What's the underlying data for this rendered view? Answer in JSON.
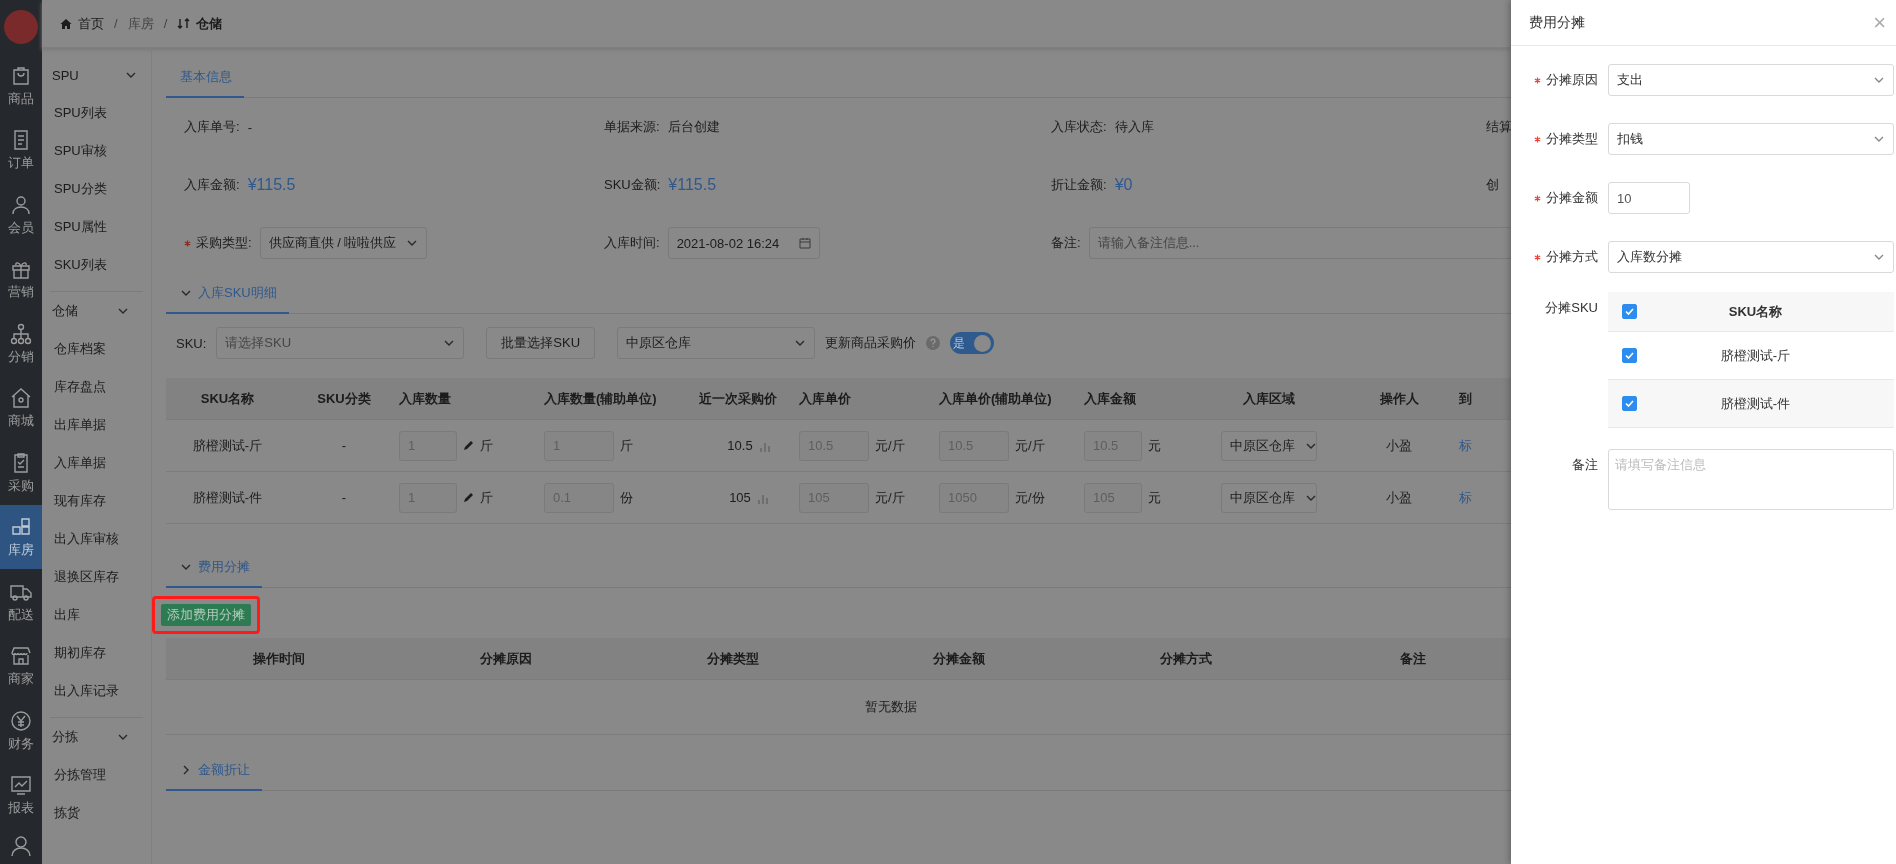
{
  "nav_rail": {
    "items": [
      {
        "label": "商品",
        "selected": false
      },
      {
        "label": "订单",
        "selected": false
      },
      {
        "label": "会员",
        "selected": false
      },
      {
        "label": "营销",
        "selected": false
      },
      {
        "label": "分销",
        "selected": false
      },
      {
        "label": "商城",
        "selected": false
      },
      {
        "label": "采购",
        "selected": false
      },
      {
        "label": "库房",
        "selected": true
      },
      {
        "label": "配送",
        "selected": false
      },
      {
        "label": "商家",
        "selected": false
      },
      {
        "label": "财务",
        "selected": false
      },
      {
        "label": "报表",
        "selected": false
      }
    ]
  },
  "submenu": {
    "groups": [
      {
        "title": "SPU",
        "expanded": true,
        "items": [
          "SPU列表",
          "SPU审核",
          "SPU分类",
          "SPU属性",
          "SKU列表"
        ]
      },
      {
        "title": "仓储",
        "expanded": true,
        "items": [
          "仓库档案",
          "库存盘点",
          "出库单据",
          "入库单据",
          "现有库存",
          "出入库审核",
          "退换区库存",
          "出库",
          "期初库存",
          "出入库记录"
        ]
      },
      {
        "title": "分拣",
        "expanded": true,
        "items": [
          "分拣管理",
          "拣货"
        ]
      }
    ]
  },
  "breadcrumb": {
    "separator": "/",
    "items": [
      {
        "label": "首页",
        "current": false
      },
      {
        "label": "库房",
        "current": false
      },
      {
        "label": "仓储",
        "current": true
      }
    ]
  },
  "basic_info": {
    "tab": "基本信息",
    "rows": [
      [
        {
          "label": "入库单号:",
          "required": false,
          "kind": "text",
          "value": "-"
        },
        {
          "label": "单据来源:",
          "required": false,
          "kind": "text",
          "value": "后台创建"
        },
        {
          "label": "入库状态:",
          "required": false,
          "kind": "text",
          "value": "待入库"
        },
        {
          "label": "结算",
          "required": false,
          "kind": "label_only"
        }
      ],
      [
        {
          "label": "入库金额:",
          "required": false,
          "kind": "amount",
          "value": "¥115.5"
        },
        {
          "label": "SKU金额:",
          "required": false,
          "kind": "amount",
          "value": "¥115.5"
        },
        {
          "label": "折让金额:",
          "required": false,
          "kind": "amount",
          "value": "¥0"
        },
        {
          "label": "创",
          "required": false,
          "kind": "label_only"
        }
      ],
      [
        {
          "label": "采购类型:",
          "required": true,
          "kind": "select",
          "value": "供应商直供 / 啦啦供应"
        },
        {
          "label": "入库时间:",
          "required": false,
          "kind": "date",
          "value": "2021-08-02 16:24"
        },
        {
          "label": "备注:",
          "required": false,
          "kind": "input",
          "placeholder": "请输入备注信息..."
        }
      ]
    ]
  },
  "sku_section": {
    "title": "入库SKU明细",
    "expanded": true,
    "toolbar": {
      "sku_label": "SKU:",
      "sku_placeholder": "请选择SKU",
      "batch_button": "批量选择SKU",
      "warehouse": "中原区仓库",
      "update_price_label": "更新商品采购价",
      "update_price": {
        "on": true,
        "text": "是"
      }
    },
    "columns": [
      "SKU名称",
      "SKU分类",
      "入库数量",
      "入库数量(辅助单位)",
      "近一次采购价",
      "入库单价",
      "入库单价(辅助单位)",
      "入库金额",
      "入库区域",
      "操作人",
      "到"
    ],
    "rows": [
      {
        "name": "脐橙测试-斤",
        "category": "-",
        "qty": "1",
        "qty_unit": "斤",
        "aux_qty": "1",
        "aux_unit": "斤",
        "last_price": "10.5",
        "price": "10.5",
        "price_unit": "元/斤",
        "aux_price": "10.5",
        "aux_price_unit": "元/斤",
        "amount": "10.5",
        "amount_unit": "元",
        "area": "中原区仓库",
        "operator": "小盈",
        "link": "标"
      },
      {
        "name": "脐橙测试-件",
        "category": "-",
        "qty": "1",
        "qty_unit": "斤",
        "aux_qty": "0.1",
        "aux_unit": "份",
        "last_price": "105",
        "price": "105",
        "price_unit": "元/斤",
        "aux_price": "1050",
        "aux_price_unit": "元/份",
        "amount": "105",
        "amount_unit": "元",
        "area": "中原区仓库",
        "operator": "小盈",
        "link": "标"
      }
    ]
  },
  "fee_section": {
    "title": "费用分摊",
    "expanded": true,
    "add_button": "添加费用分摊",
    "columns": [
      "操作时间",
      "分摊原因",
      "分摊类型",
      "分摊金额",
      "分摊方式",
      "备注"
    ],
    "empty_text": "暂无数据"
  },
  "discount_section": {
    "title": "金额折让",
    "expanded": false
  },
  "drawer": {
    "title": "费用分摊",
    "close": "×",
    "fields": [
      {
        "label": "分摊原因",
        "required": true,
        "kind": "select",
        "value": "支出"
      },
      {
        "label": "分摊类型",
        "required": true,
        "kind": "select",
        "value": "扣钱"
      },
      {
        "label": "分摊金额",
        "required": true,
        "kind": "number",
        "value": "10"
      },
      {
        "label": "分摊方式",
        "required": true,
        "kind": "select",
        "value": "入库数分摊"
      }
    ],
    "sku_select": {
      "label": "分摊SKU",
      "header": {
        "label": "SKU名称",
        "checked": true
      },
      "rows": [
        {
          "name": "脐橙测试-斤",
          "checked": true
        },
        {
          "name": "脐橙测试-件",
          "checked": true
        }
      ]
    },
    "remark": {
      "label": "备注",
      "placeholder": "请填写备注信息"
    }
  }
}
